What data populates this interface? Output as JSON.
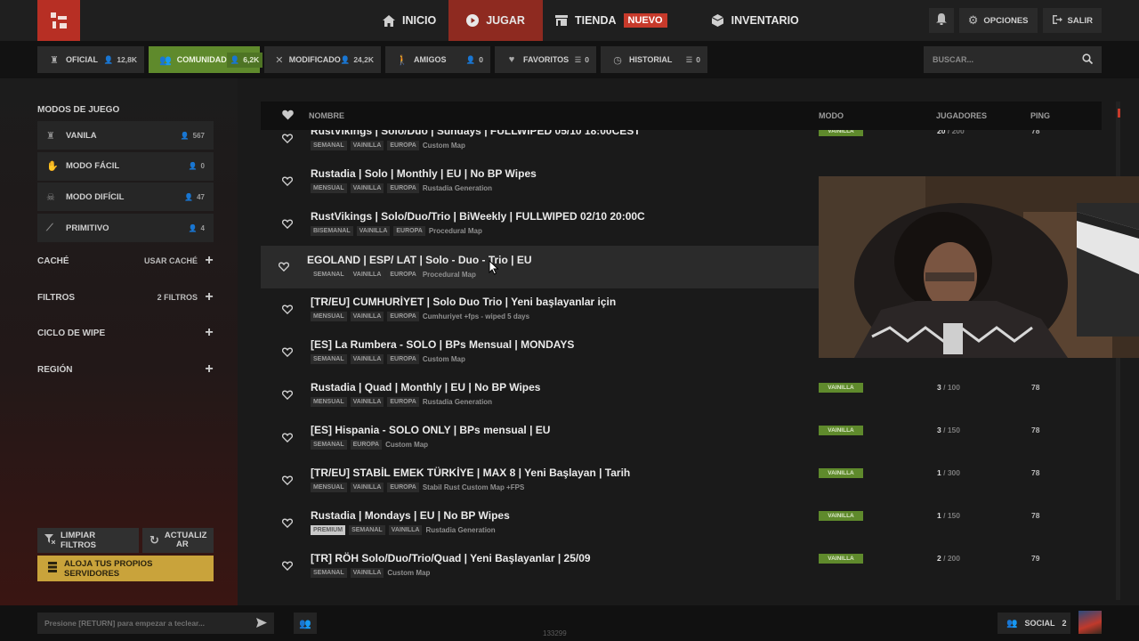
{
  "nav": {
    "items": [
      {
        "label": "INICIO",
        "icon": "home-icon"
      },
      {
        "label": "JUGAR",
        "icon": "play-icon"
      },
      {
        "label": "TIENDA",
        "icon": "store-icon",
        "badge": "NUEVO"
      },
      {
        "label": "INVENTARIO",
        "icon": "box-icon"
      }
    ],
    "options_label": "OPCIONES",
    "exit_label": "SALIR"
  },
  "filters": {
    "tabs": [
      {
        "label": "OFICIAL",
        "count": "12,8K",
        "icon": "rust-icon"
      },
      {
        "label": "COMUNIDAD",
        "count": "6,2K",
        "icon": "community-icon"
      },
      {
        "label": "MODIFICADO",
        "count": "24,2K",
        "icon": "tools-icon"
      },
      {
        "label": "AMIGOS",
        "count": "0",
        "icon": "friends-icon"
      },
      {
        "label": "FAVORITOS",
        "count": "0",
        "icon": "heart-icon"
      },
      {
        "label": "HISTORIAL",
        "count": "0",
        "icon": "history-icon"
      }
    ],
    "search_placeholder": "BUSCAR..."
  },
  "sidebar": {
    "modes_title": "MODOS DE JUEGO",
    "modes": [
      {
        "label": "VANILA",
        "count": "567"
      },
      {
        "label": "MODO FÁCIL",
        "count": "0"
      },
      {
        "label": "MODO DIFÍCIL",
        "count": "47"
      },
      {
        "label": "PRIMITIVO",
        "count": "4"
      }
    ],
    "cache_label": "CACHÉ",
    "cache_value": "USAR CACHÉ",
    "filters_label": "FILTROS",
    "filters_value": "2 FILTROS",
    "wipe_label": "CICLO DE WIPE",
    "region_label": "REGIÓN",
    "clear_label": "LIMPIAR FILTROS",
    "refresh_label": "ACTUALIZ AR",
    "host_label": "ALOJA TUS PROPIOS SERVIDORES"
  },
  "table": {
    "col_name": "NOMBRE",
    "col_mode": "MODO",
    "col_players": "JUGADORES",
    "col_ping": "PING",
    "rows": [
      {
        "name": "RustVikings | Solo/Duo | Sundays | FULLWIPED 05/10 18:00CEST",
        "tags": [
          "SEMANAL",
          "VAINILLA",
          "EUROPA"
        ],
        "map": "Custom Map",
        "mode": "VAINILLA",
        "players": "20",
        "max": "/ 200",
        "ping": "78"
      },
      {
        "name": "Rustadia | Solo | Monthly | EU | No BP Wipes",
        "tags": [
          "MENSUAL",
          "VAINILLA",
          "EUROPA"
        ],
        "map": "Rustadia Generation",
        "mode": "",
        "players": "",
        "max": "",
        "ping": ""
      },
      {
        "name": "RustVikings | Solo/Duo/Trio | BiWeekly | FULLWIPED 02/10 20:00C",
        "tags": [
          "BISEMANAL",
          "VAINILLA",
          "EUROPA"
        ],
        "map": "Procedural Map",
        "mode": "",
        "players": "",
        "max": "",
        "ping": ""
      },
      {
        "name": "EGOLAND | ESP/ LAT | Solo - Duo - Trio | EU",
        "tags": [
          "SEMANAL",
          "VAINILLA",
          "EUROPA"
        ],
        "map": "Procedural Map",
        "mode": "",
        "players": "",
        "max": "",
        "ping": ""
      },
      {
        "name": "[TR/EU] CUMHURİYET | Solo Duo Trio | Yeni başlayanlar için",
        "tags": [
          "MENSUAL",
          "VAINILLA",
          "EUROPA"
        ],
        "map": "Cumhuriyet +fps - wiped 5 days",
        "mode": "",
        "players": "",
        "max": "",
        "ping": ""
      },
      {
        "name": "[ES] La Rumbera - SOLO | BPs Mensual | MONDAYS",
        "tags": [
          "SEMANAL",
          "VAINILLA",
          "EUROPA"
        ],
        "map": "Custom Map",
        "mode": "",
        "players": "",
        "max": "",
        "ping": ""
      },
      {
        "name": "Rustadia | Quad | Monthly | EU | No BP Wipes",
        "tags": [
          "MENSUAL",
          "VAINILLA",
          "EUROPA"
        ],
        "map": "Rustadia Generation",
        "mode": "VAINILLA",
        "players": "3",
        "max": "/ 100",
        "ping": "78"
      },
      {
        "name": "[ES] Hispania - SOLO ONLY | BPs mensual | EU",
        "tags": [
          "SEMANAL",
          "EUROPA"
        ],
        "map": "Custom Map",
        "mode": "VAINILLA",
        "players": "3",
        "max": "/ 150",
        "ping": "78"
      },
      {
        "name": "[TR/EU] STABİL EMEK TÜRKİYE | MAX 8 | Yeni Başlayan | Tarih",
        "tags": [
          "MENSUAL",
          "VAINILLA",
          "EUROPA"
        ],
        "map": "Stabil Rust Custom Map +FPS",
        "mode": "VAINILLA",
        "players": "1",
        "max": "/ 300",
        "ping": "78"
      },
      {
        "name": "Rustadia | Mondays | EU | No BP Wipes",
        "tags": [
          "PREMIUM",
          "SEMANAL",
          "VAINILLA"
        ],
        "map": "Rustadia Generation",
        "mode": "VAINILLA",
        "players": "1",
        "max": "/ 150",
        "ping": "78"
      },
      {
        "name": "[TR] RÖH Solo/Duo/Trio/Quad | Yeni Başlayanlar | 25/09",
        "tags": [
          "SEMANAL",
          "VAINILLA"
        ],
        "map": "Custom Map",
        "mode": "VAINILLA",
        "players": "2",
        "max": "/ 200",
        "ping": "79"
      }
    ]
  },
  "bottom": {
    "chat_placeholder": "Presione [RETURN] para empezar a teclear...",
    "center_number": "133299",
    "social_label": "SOCIAL",
    "social_count": "2"
  },
  "colors": {
    "accent_red": "#b72f24",
    "active_green": "#5f8a2c",
    "host_gold": "#c9a33b"
  }
}
